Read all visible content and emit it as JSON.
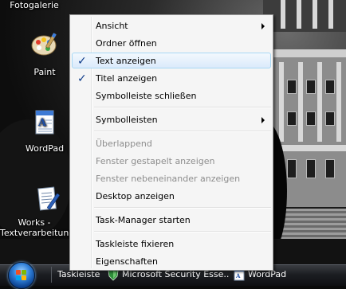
{
  "desktop": {
    "title_top": "Fotogalerie",
    "icons": [
      {
        "label": "Paint",
        "icon": "paint-palette-icon"
      },
      {
        "label": "WordPad",
        "icon": "wordpad-document-icon"
      },
      {
        "label_line1": "Works -",
        "label_line2": "Textverarbeitung",
        "icon": "works-word-processor-icon"
      }
    ]
  },
  "context_menu": {
    "items": [
      {
        "label": "Ansicht",
        "submenu": true
      },
      {
        "label": "Ordner öffnen"
      },
      {
        "label": "Text anzeigen",
        "checked": true,
        "highlighted": true
      },
      {
        "label": "Titel anzeigen",
        "checked": true
      },
      {
        "label": "Symbolleiste schließen"
      },
      {
        "label": "Symbolleisten",
        "submenu": true
      },
      {
        "label": "Überlappend",
        "disabled": true
      },
      {
        "label": "Fenster gestapelt anzeigen",
        "disabled": true
      },
      {
        "label": "Fenster nebeneinander anzeigen",
        "disabled": true
      },
      {
        "label": "Desktop anzeigen"
      },
      {
        "label": "Task-Manager starten"
      },
      {
        "label": "Taskleiste fixieren"
      },
      {
        "label": "Eigenschaften"
      }
    ],
    "check_glyph": "✓"
  },
  "taskbar": {
    "toolbar_label": "Taskleiste",
    "buttons": [
      {
        "label": "Microsoft Security Esse...",
        "icon": "security-essentials-icon"
      },
      {
        "label": "WordPad",
        "icon": "wordpad-icon"
      }
    ]
  },
  "colors": {
    "menu_bg": "#f5f5f5",
    "menu_border": "#979797",
    "hover_border": "#a8d8f5",
    "check": "#0f3c8a",
    "disabled_text": "#8d8d8d"
  }
}
